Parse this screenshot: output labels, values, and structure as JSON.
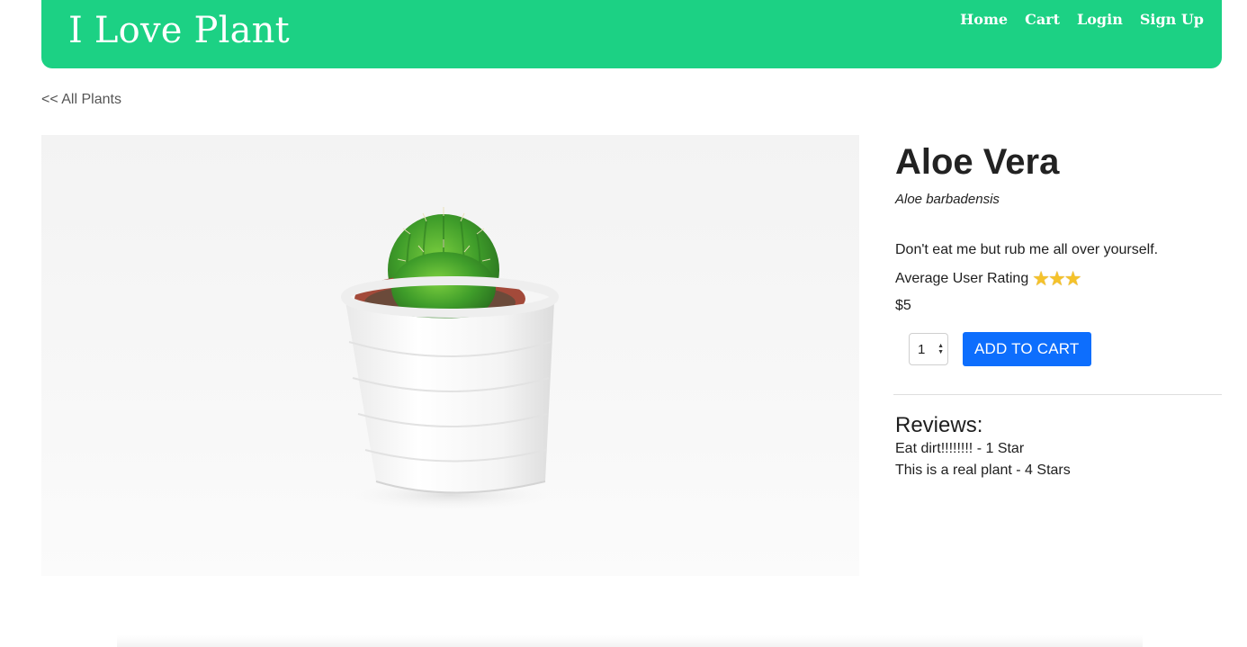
{
  "navbar": {
    "brand": "I Love Plant",
    "links": [
      {
        "label": "Home"
      },
      {
        "label": "Cart"
      },
      {
        "label": "Login"
      },
      {
        "label": "Sign Up"
      }
    ],
    "color": "#1cd184"
  },
  "back_link": {
    "label": "<< All Plants"
  },
  "product": {
    "name": "Aloe Vera",
    "scientific_name": "Aloe barbadensis",
    "description": "Don't eat me but rub me all over yourself.",
    "rating_label": "Average User Rating",
    "rating": 3,
    "rating_icon": "star-icon",
    "price": "$5",
    "image": "potted-cactus-photo"
  },
  "cart": {
    "quantity": "1",
    "add_label": "ADD TO CART",
    "button_color": "#0d6efd"
  },
  "reviews": {
    "title": "Reviews:",
    "items": [
      {
        "text": "Eat dirt!!!!!!!! - 1 Star"
      },
      {
        "text": "This is a real plant - 4 Stars"
      }
    ]
  }
}
